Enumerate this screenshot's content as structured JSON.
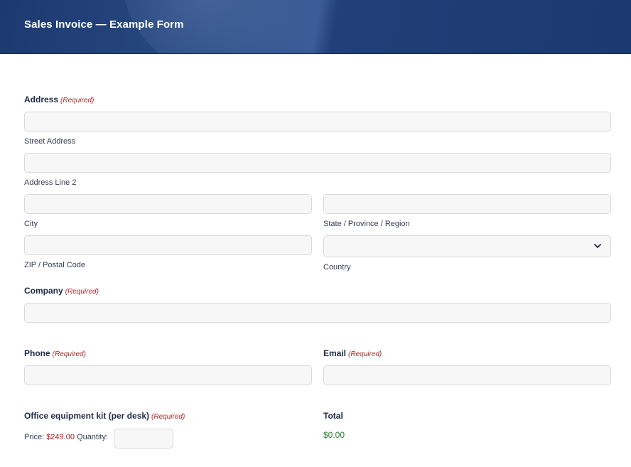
{
  "header": {
    "title": "Sales Invoice — Example Form"
  },
  "required_marker": "(Required)",
  "address": {
    "label": "Address",
    "street_sub": "Street Address",
    "line2_sub": "Address Line 2",
    "city_sub": "City",
    "state_sub": "State / Province / Region",
    "zip_sub": "ZIP / Postal Code",
    "country_sub": "Country",
    "country_selected": ""
  },
  "company": {
    "label": "Company"
  },
  "phone": {
    "label": "Phone"
  },
  "email": {
    "label": "Email"
  },
  "product": {
    "label": "Office equipment kit (per desk)",
    "price_prefix": "Price:",
    "price": "$249.00",
    "quantity_label": "Quantity:",
    "quantity_value": ""
  },
  "total": {
    "label": "Total",
    "value": "$0.00"
  },
  "colors": {
    "header_bg": "#1c3a70",
    "required": "#b0262b",
    "price": "#9b1c1c",
    "total": "#2e7d32"
  },
  "icons": {
    "country_dropdown": "chevron-down-icon"
  }
}
